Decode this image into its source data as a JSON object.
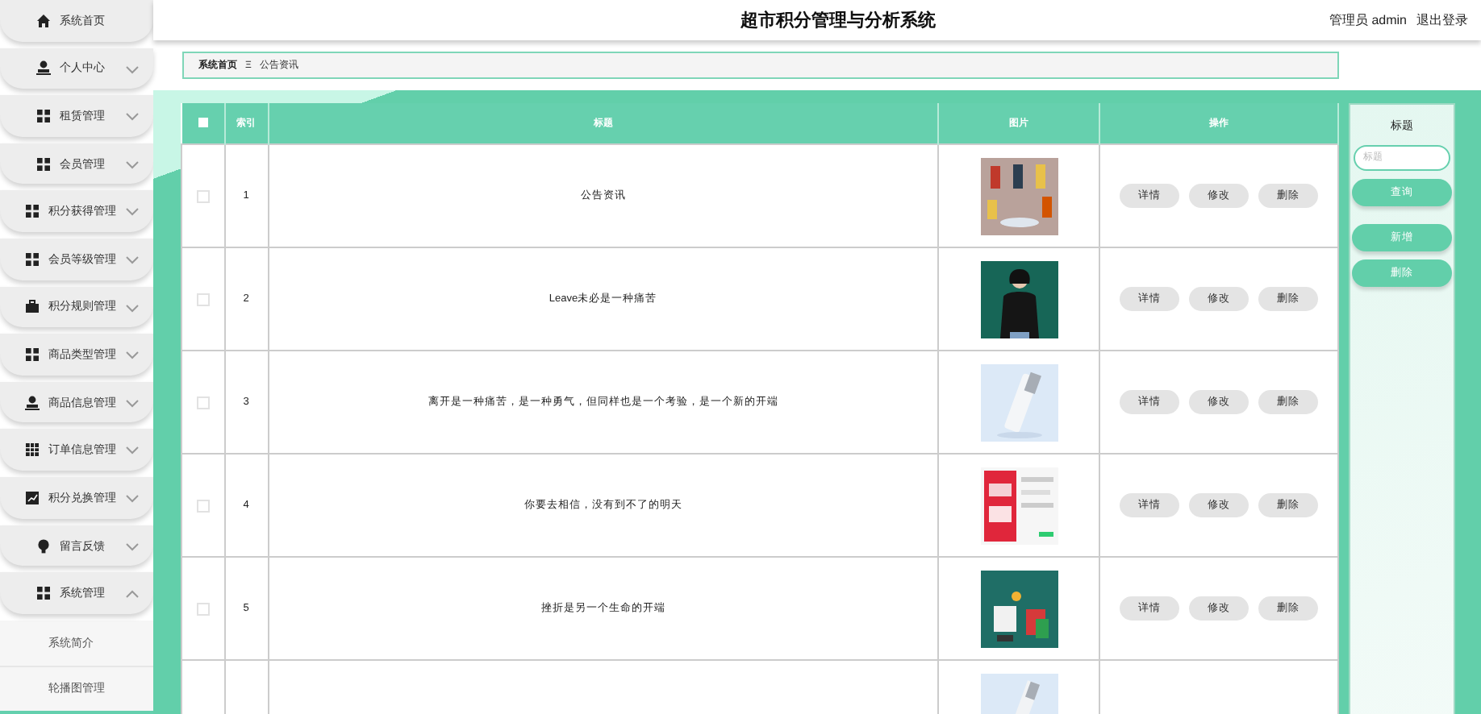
{
  "sidebar": {
    "items": [
      {
        "label": "系统首页",
        "kind": "home"
      },
      {
        "label": "个人中心",
        "kind": "person",
        "expanded": false
      },
      {
        "label": "租赁管理",
        "kind": "grid",
        "expanded": false
      },
      {
        "label": "会员管理",
        "kind": "grid",
        "expanded": false
      },
      {
        "label": "积分获得管理",
        "kind": "grid",
        "expanded": false
      },
      {
        "label": "会员等级管理",
        "kind": "grid",
        "expanded": false
      },
      {
        "label": "积分规则管理",
        "kind": "case",
        "expanded": false
      },
      {
        "label": "商品类型管理",
        "kind": "grid",
        "expanded": false
      },
      {
        "label": "商品信息管理",
        "kind": "person",
        "expanded": false
      },
      {
        "label": "订单信息管理",
        "kind": "table",
        "expanded": false
      },
      {
        "label": "积分兑换管理",
        "kind": "chart",
        "expanded": false
      },
      {
        "label": "留言反馈",
        "kind": "bulb",
        "expanded": false
      },
      {
        "label": "系统管理",
        "kind": "grid",
        "expanded": true,
        "children": [
          {
            "label": "系统简介"
          },
          {
            "label": "轮播图管理"
          }
        ]
      }
    ]
  },
  "header": {
    "title": "超市积分管理与分析系统",
    "user": "管理员 admin",
    "logout": "退出登录"
  },
  "breadcrumb": {
    "home": "系统首页",
    "separator": "Ξ",
    "current": "公告资讯"
  },
  "table": {
    "select_all": {
      "checked": false
    },
    "columns": [
      "索引",
      "标题",
      "图片",
      "操作"
    ],
    "rows": [
      {
        "checked": false,
        "index": "1",
        "title": "公告资讯",
        "actions": [
          "详情",
          "修改",
          "删除"
        ]
      },
      {
        "checked": false,
        "index": "2",
        "title": "Leave未必是一种痛苦",
        "actions": [
          "详情",
          "修改",
          "删除"
        ]
      },
      {
        "checked": false,
        "index": "3",
        "title": "离开是一种痛苦，是一种勇气，但同样也是一个考验，是一个新的开端",
        "actions": [
          "详情",
          "修改",
          "删除"
        ]
      },
      {
        "checked": false,
        "index": "4",
        "title": "你要去相信，没有到不了的明天",
        "actions": [
          "详情",
          "修改",
          "删除"
        ]
      },
      {
        "checked": false,
        "index": "5",
        "title": "挫折是另一个生命的开端",
        "actions": [
          "详情",
          "修改",
          "删除"
        ]
      },
      {
        "kind": "partial"
      }
    ]
  },
  "search_panel": {
    "label": "标题",
    "placeholder": "标题",
    "buttons": [
      "查询",
      "新增",
      "删除"
    ]
  }
}
